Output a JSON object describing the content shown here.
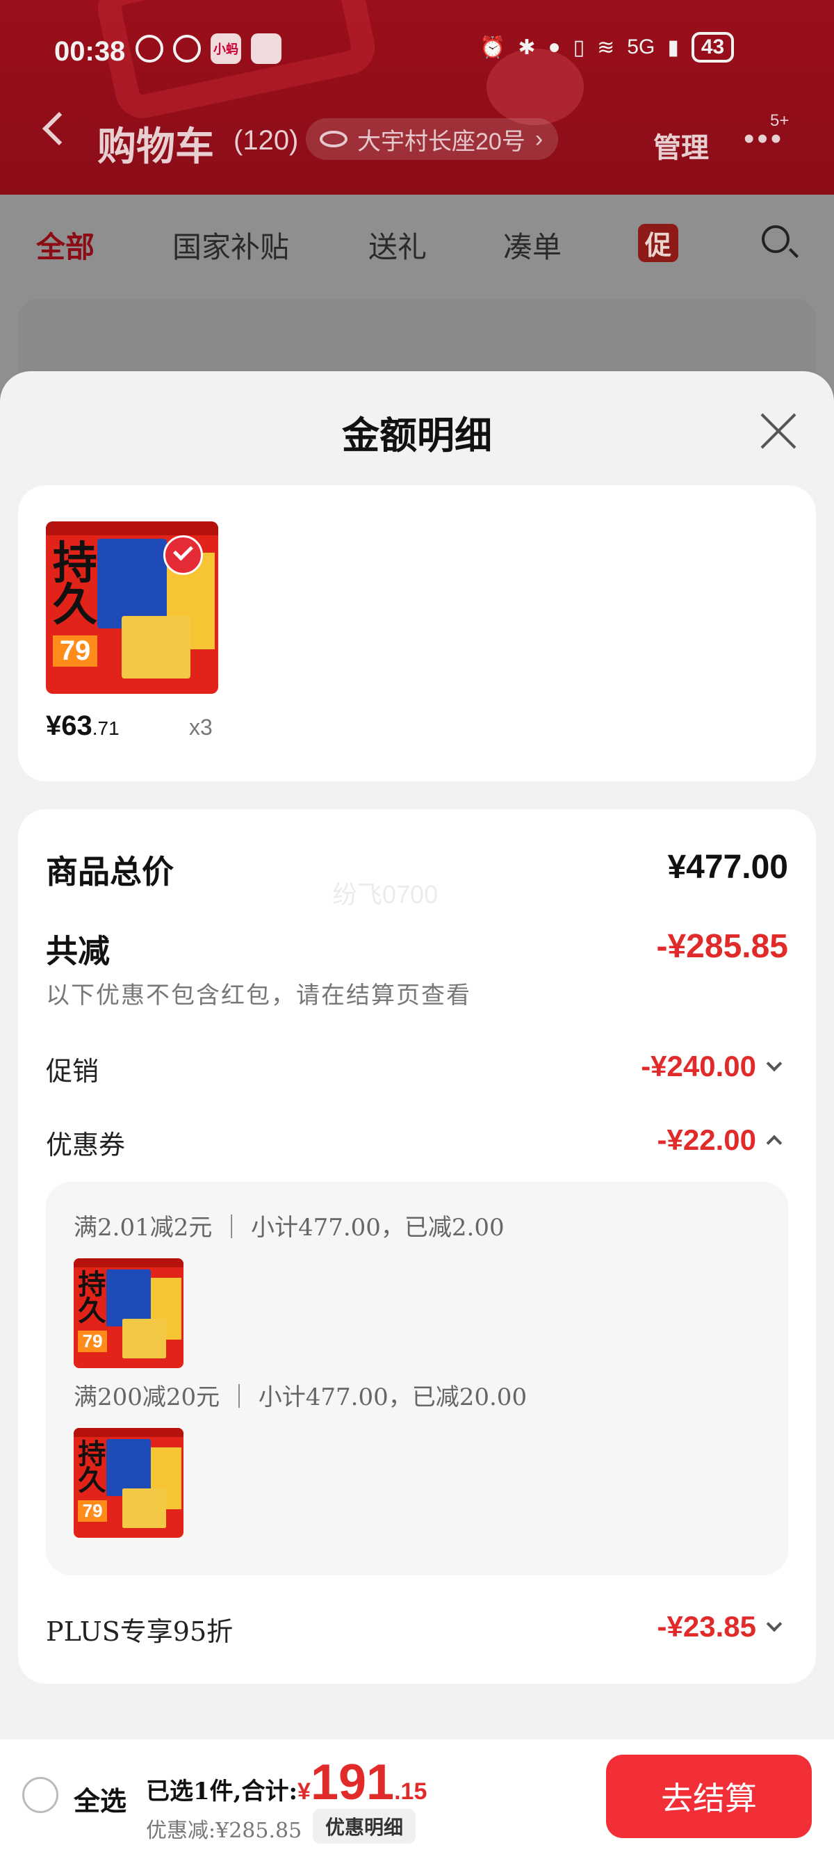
{
  "status_bar": {
    "time": "00:38",
    "app_badge": "小蚂",
    "network": "5G",
    "battery": "43"
  },
  "cart_header": {
    "title": "购物车",
    "count": "(120)",
    "address": "大宇村长座20号",
    "manage": "管理",
    "more_badge": "5+"
  },
  "tabs": [
    "全部",
    "国家补贴",
    "送礼",
    "凑单"
  ],
  "promo_tag": "促",
  "sheet": {
    "title": "金额明细",
    "goods": {
      "price_int": "¥63",
      "price_dec": ".71",
      "qty": "x3",
      "thumb_text_top": "持久",
      "thumb_text_price": "79"
    },
    "watermark": "纷飞0700",
    "total_label": "商品总价",
    "total_value": "¥477.00",
    "reduce_label": "共减",
    "reduce_value": "-¥285.85",
    "reduce_note": "以下优惠不包含红包，请在结算页查看",
    "promo_label": "促销",
    "promo_value": "-¥240.00",
    "coupon_label": "优惠券",
    "coupon_value": "-¥22.00",
    "coupons": [
      {
        "text": "满2.01减2元 ｜ 小计477.00，已减2.00"
      },
      {
        "text": "满200减20元 ｜ 小计477.00，已减20.00"
      }
    ],
    "plus_label": "PLUS专享95折",
    "plus_value": "-¥23.85"
  },
  "bottom_bar": {
    "select_all": "全选",
    "selected_text": "已选1件,合计:",
    "yen": "¥",
    "total_int": "191",
    "total_dec": ".15",
    "discount_text": "优惠减:¥285.85",
    "detail_button": "优惠明细",
    "checkout_button": "去结算"
  },
  "colors": {
    "accent_red": "#e12b2b",
    "checkout_red": "#f22e37",
    "header_red": "#9a0f1b"
  },
  "icons": [
    "back-icon",
    "eye-icon",
    "more-icon",
    "search-icon",
    "close-icon",
    "check-icon",
    "chevron-down-icon",
    "chevron-up-icon",
    "radio-icon"
  ]
}
